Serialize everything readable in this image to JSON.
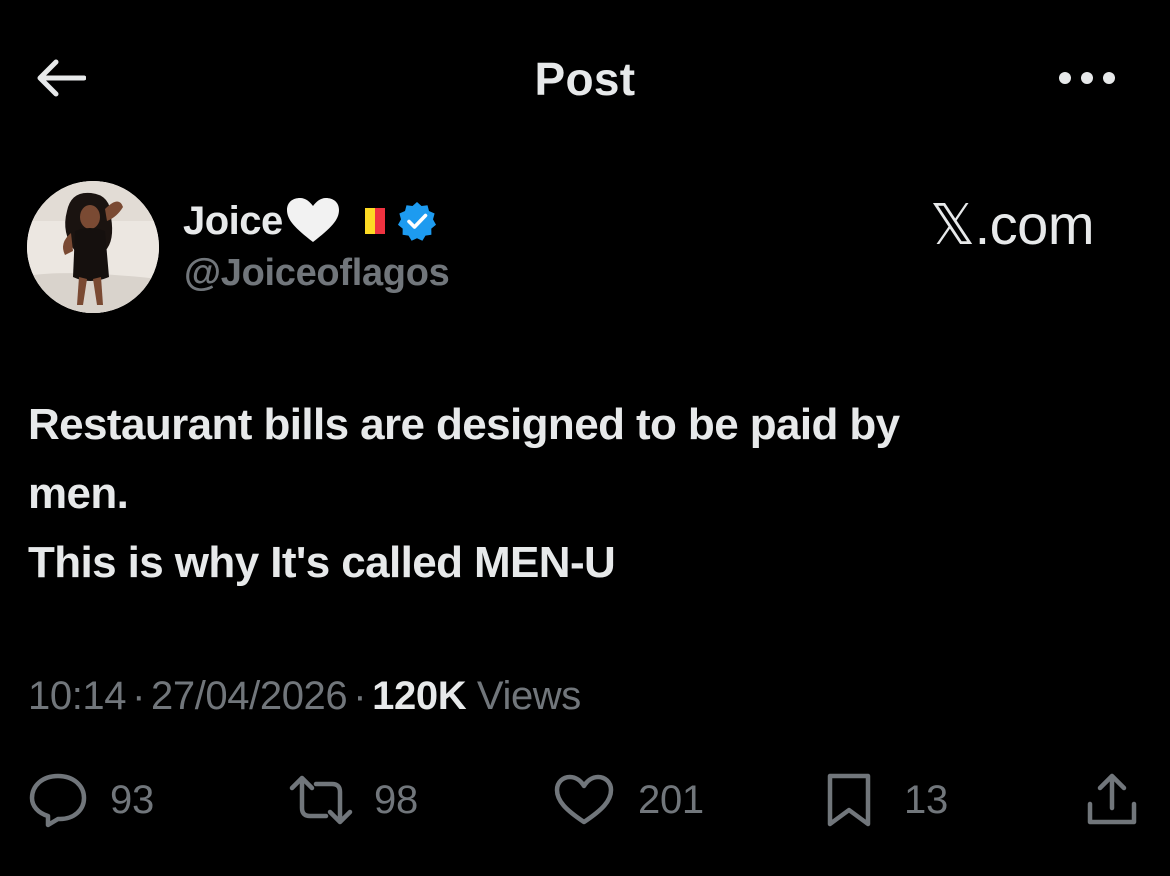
{
  "header": {
    "title": "Post",
    "back_icon": "arrow-left-icon",
    "more_icon": "more-horizontal-icon"
  },
  "author": {
    "display_name": "Joice",
    "emojis": [
      "white-heart",
      "belgium-flag"
    ],
    "handle": "@Joiceoflagos",
    "verified": true,
    "verified_color": "#1d9bf0"
  },
  "watermark": "𝕏.com",
  "post": {
    "lines": [
      "Restaurant bills are designed to be paid by",
      "men.",
      "This is why It's called MEN-U"
    ]
  },
  "meta": {
    "time": "10:14",
    "date": "27/04/2026",
    "separator": "·",
    "views_count": "120K",
    "views_label": "Views"
  },
  "actions": {
    "replies": "93",
    "reposts": "98",
    "likes": "201",
    "bookmarks": "13"
  },
  "colors": {
    "background": "#000000",
    "primary_text": "#e7e9ea",
    "secondary_text": "#71767b"
  }
}
